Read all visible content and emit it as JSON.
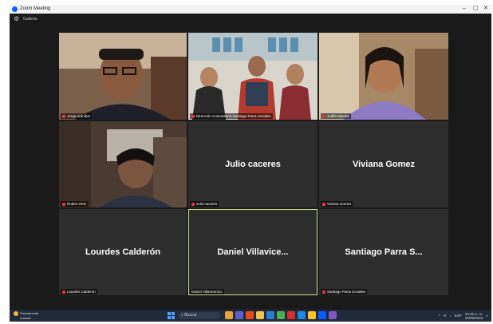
{
  "window": {
    "title": "Zoom Meeting",
    "controls": [
      "–",
      "▢",
      "✕"
    ]
  },
  "toolbar": {
    "view_label": "Galleria"
  },
  "tiles": [
    {
      "name_tag": "Jorge Aranibar",
      "type": "video"
    },
    {
      "name_tag": "Dirección Comunitaria Santiago Parra Sociales",
      "type": "video"
    },
    {
      "name_tag": "Judith Macías",
      "type": "video"
    },
    {
      "name_tag": "Ruben Ortiz",
      "type": "video"
    },
    {
      "center_name": "Julio caceres",
      "name_tag": "Julio caceres",
      "type": "name"
    },
    {
      "center_name": "Viviana Gomez",
      "name_tag": "Viviana Gomez",
      "type": "name"
    },
    {
      "center_name": "Lourdes Calderón",
      "name_tag": "Lourdes Calderón",
      "type": "name"
    },
    {
      "center_name": "Daniel  Villavice...",
      "name_tag": "Daniel Villavicencio",
      "type": "name",
      "active": true
    },
    {
      "center_name": "Santiago Parra S...",
      "name_tag": "Santiago Parra Sociales",
      "type": "name"
    }
  ],
  "taskbar": {
    "weather_line1": "Parcialmente",
    "weather_line2": "nublado",
    "search_placeholder": "Buscar",
    "time": "10:45 a. m.",
    "date": "20/06/2023",
    "tray_lang": "ESP",
    "colors": {
      "start": "#4aa3ff",
      "accent": "#0b5cff"
    }
  }
}
